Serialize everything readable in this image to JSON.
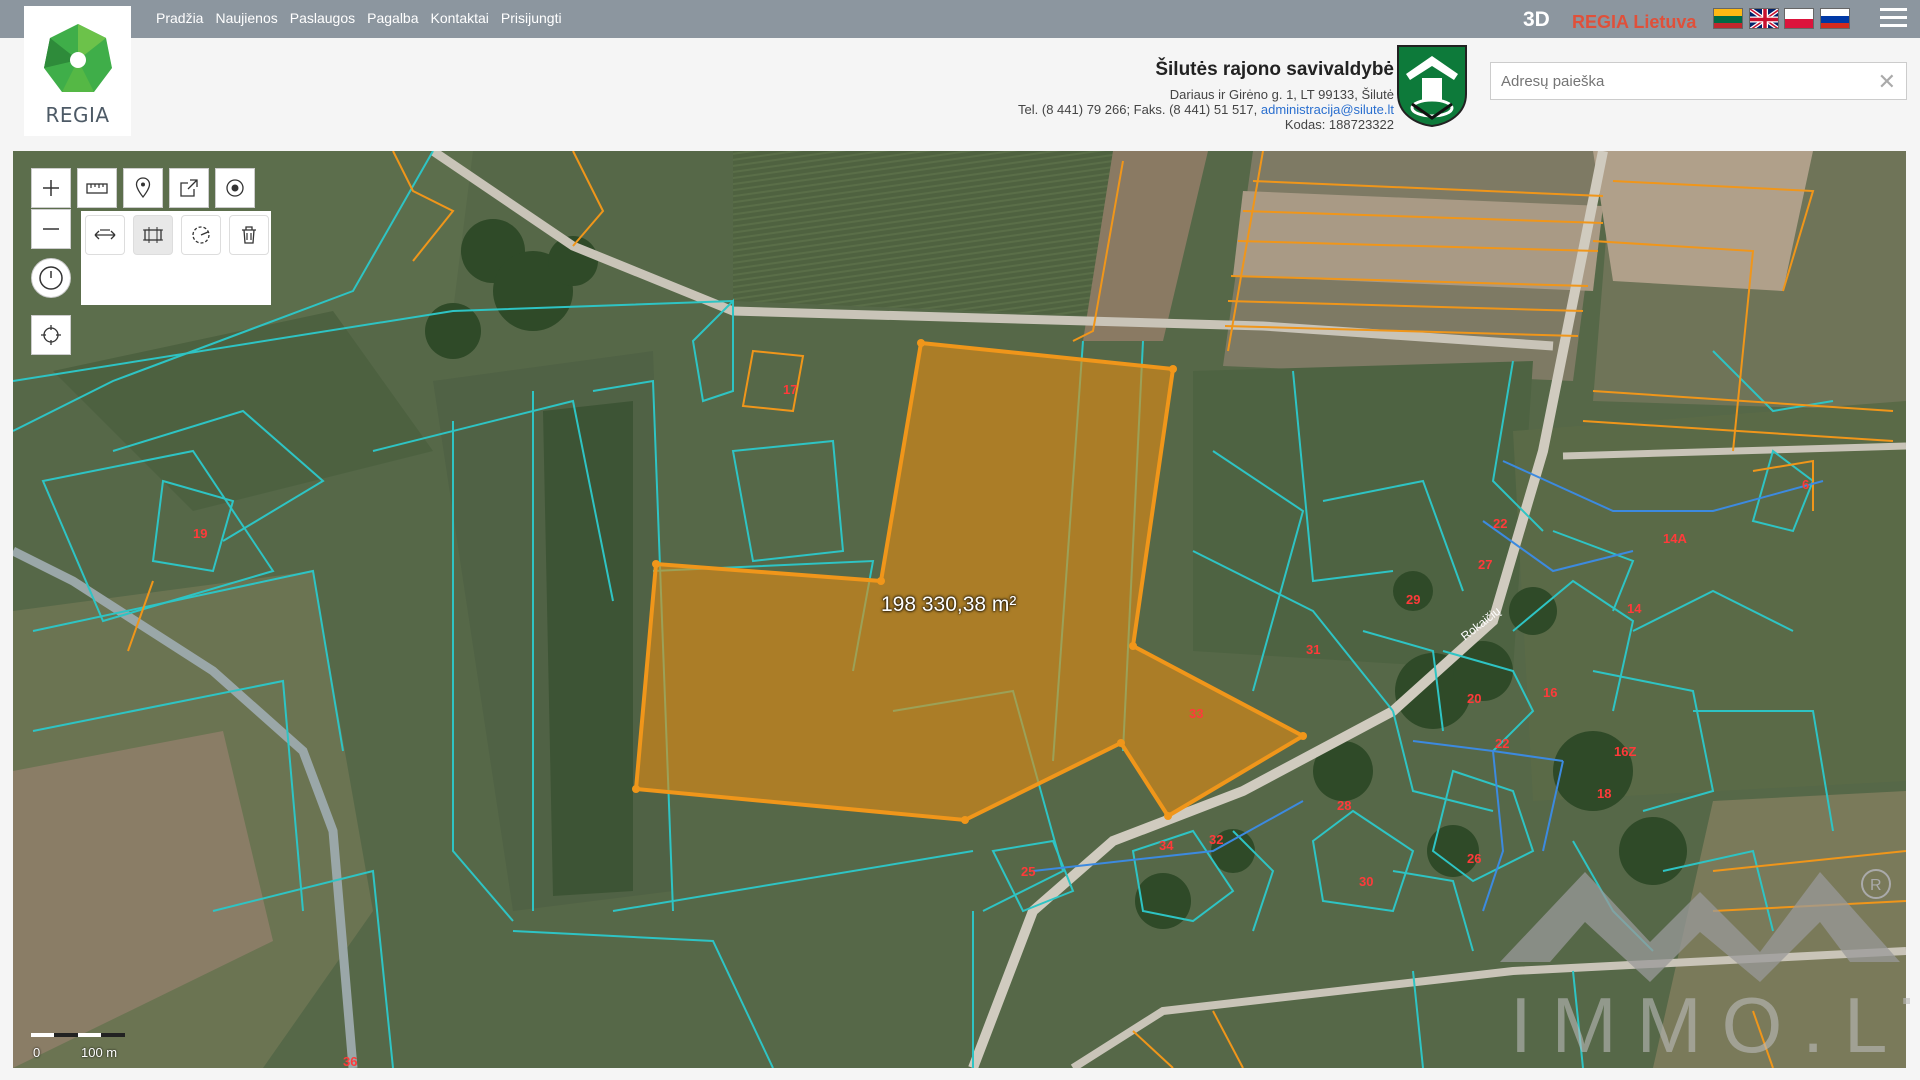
{
  "nav": {
    "items": [
      "Pradžia",
      "Naujienos",
      "Paslaugos",
      "Pagalba",
      "Kontaktai",
      "Prisijungti"
    ]
  },
  "logo": {
    "text": "REGIA"
  },
  "top_right": {
    "btn_3d": "3D",
    "regia_lietuva": "REGIA Lietuva",
    "languages": [
      "lt",
      "en",
      "pl",
      "ru"
    ]
  },
  "municipality": {
    "title": "Šilutės rajono savivaldybė",
    "address": "Dariaus ir Girėno g. 1, LT 99133, Šilutė",
    "phone": "Tel. (8 441) 79 266; Faks. (8 441) 51 517, ",
    "email": "administracija@silute.lt",
    "code": "Kodas: 188723322"
  },
  "search": {
    "placeholder": "Adresų paieška",
    "value": ""
  },
  "map": {
    "area_label": "198 330,38 m²",
    "scale_zero": "0",
    "scale_distance": "100 m",
    "street_label": "Rokaičių",
    "plot_numbers": [
      "17",
      "19",
      "22",
      "27",
      "29",
      "14A",
      "14",
      "6",
      "31",
      "33",
      "20",
      "16",
      "22",
      "16Z",
      "18",
      "28",
      "34",
      "32",
      "25",
      "30",
      "26",
      "36"
    ],
    "highlight_color": "#f0961a",
    "parcel_border_color": "#2ec4c4"
  },
  "watermark": {
    "text": "IMMO.LT"
  }
}
